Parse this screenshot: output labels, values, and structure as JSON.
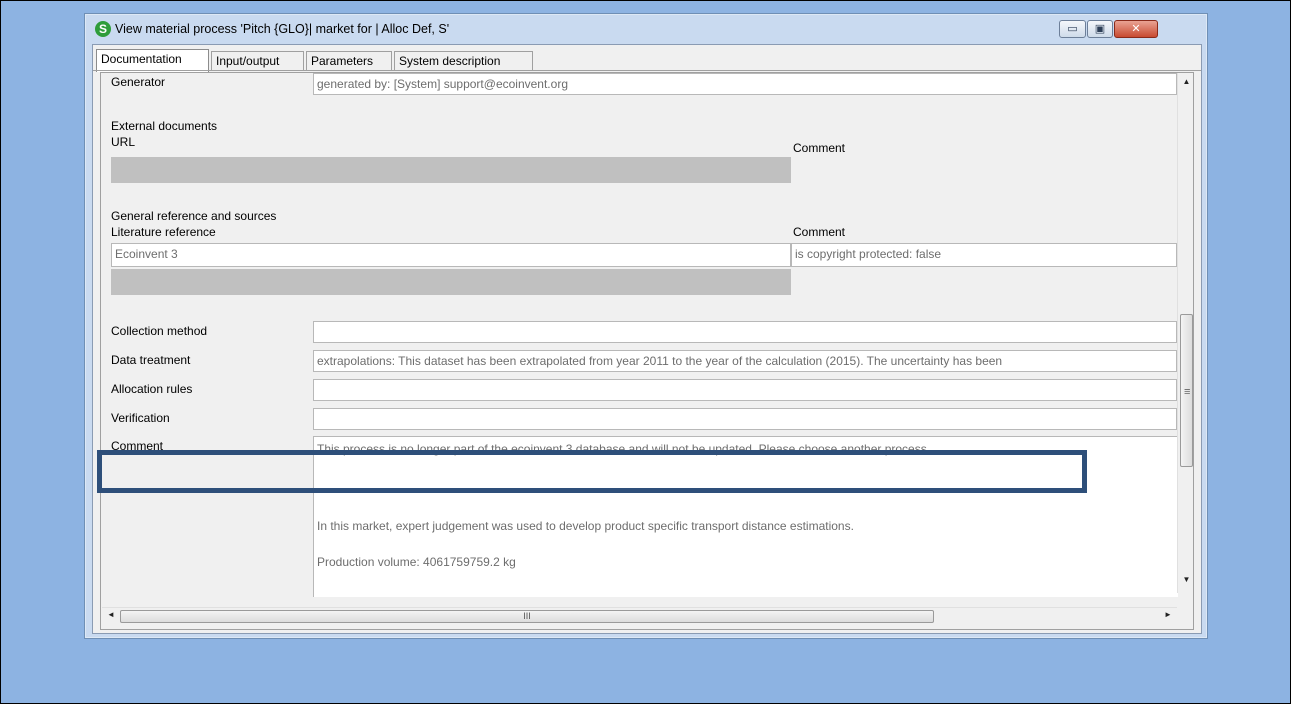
{
  "window": {
    "title": "View material process 'Pitch {GLO}| market for | Alloc Def, S'",
    "app_icon": "S",
    "controls": {
      "minimize": "▭",
      "maximize": "▣",
      "close": "✕"
    }
  },
  "tabs": [
    {
      "label": "Documentation",
      "active": true
    },
    {
      "label": "Input/output"
    },
    {
      "label": "Parameters"
    },
    {
      "label": "System description"
    }
  ],
  "doc": {
    "generator": {
      "label": "Generator",
      "value": "generated by: [System] support@ecoinvent.org"
    },
    "external_documents": {
      "heading": "External documents",
      "url_label": "URL",
      "comment_label": "Comment"
    },
    "general_reference": {
      "heading": "General reference and sources",
      "literature_label": "Literature reference",
      "comment_label": "Comment",
      "literature_value": "Ecoinvent 3",
      "comment_value": "is copyright protected: false"
    },
    "collection_method": {
      "label": "Collection method",
      "value": ""
    },
    "data_treatment": {
      "label": "Data treatment",
      "value": "extrapolations: This dataset has been extrapolated from year 2011 to the year of the calculation (2015). The uncertainty has been"
    },
    "allocation_rules": {
      "label": "Allocation rules",
      "value": ""
    },
    "verification": {
      "label": "Verification",
      "value": ""
    },
    "comment": {
      "label": "Comment",
      "line1": "This process is no longer part of the ecoinvent 3 database and will not be updated. Please choose another process.",
      "line2": "In this market, expert judgement was used to develop product specific transport distance estimations.",
      "line3": "Production volume: 4061759759.2 kg"
    }
  },
  "scroll": {
    "up": "▲",
    "down": "▼",
    "left": "◄",
    "right": "►",
    "grip": "≡",
    "hgrip": "III"
  },
  "colors": {
    "desktop": "#8db3e2",
    "highlight": "#2e4f7a"
  }
}
